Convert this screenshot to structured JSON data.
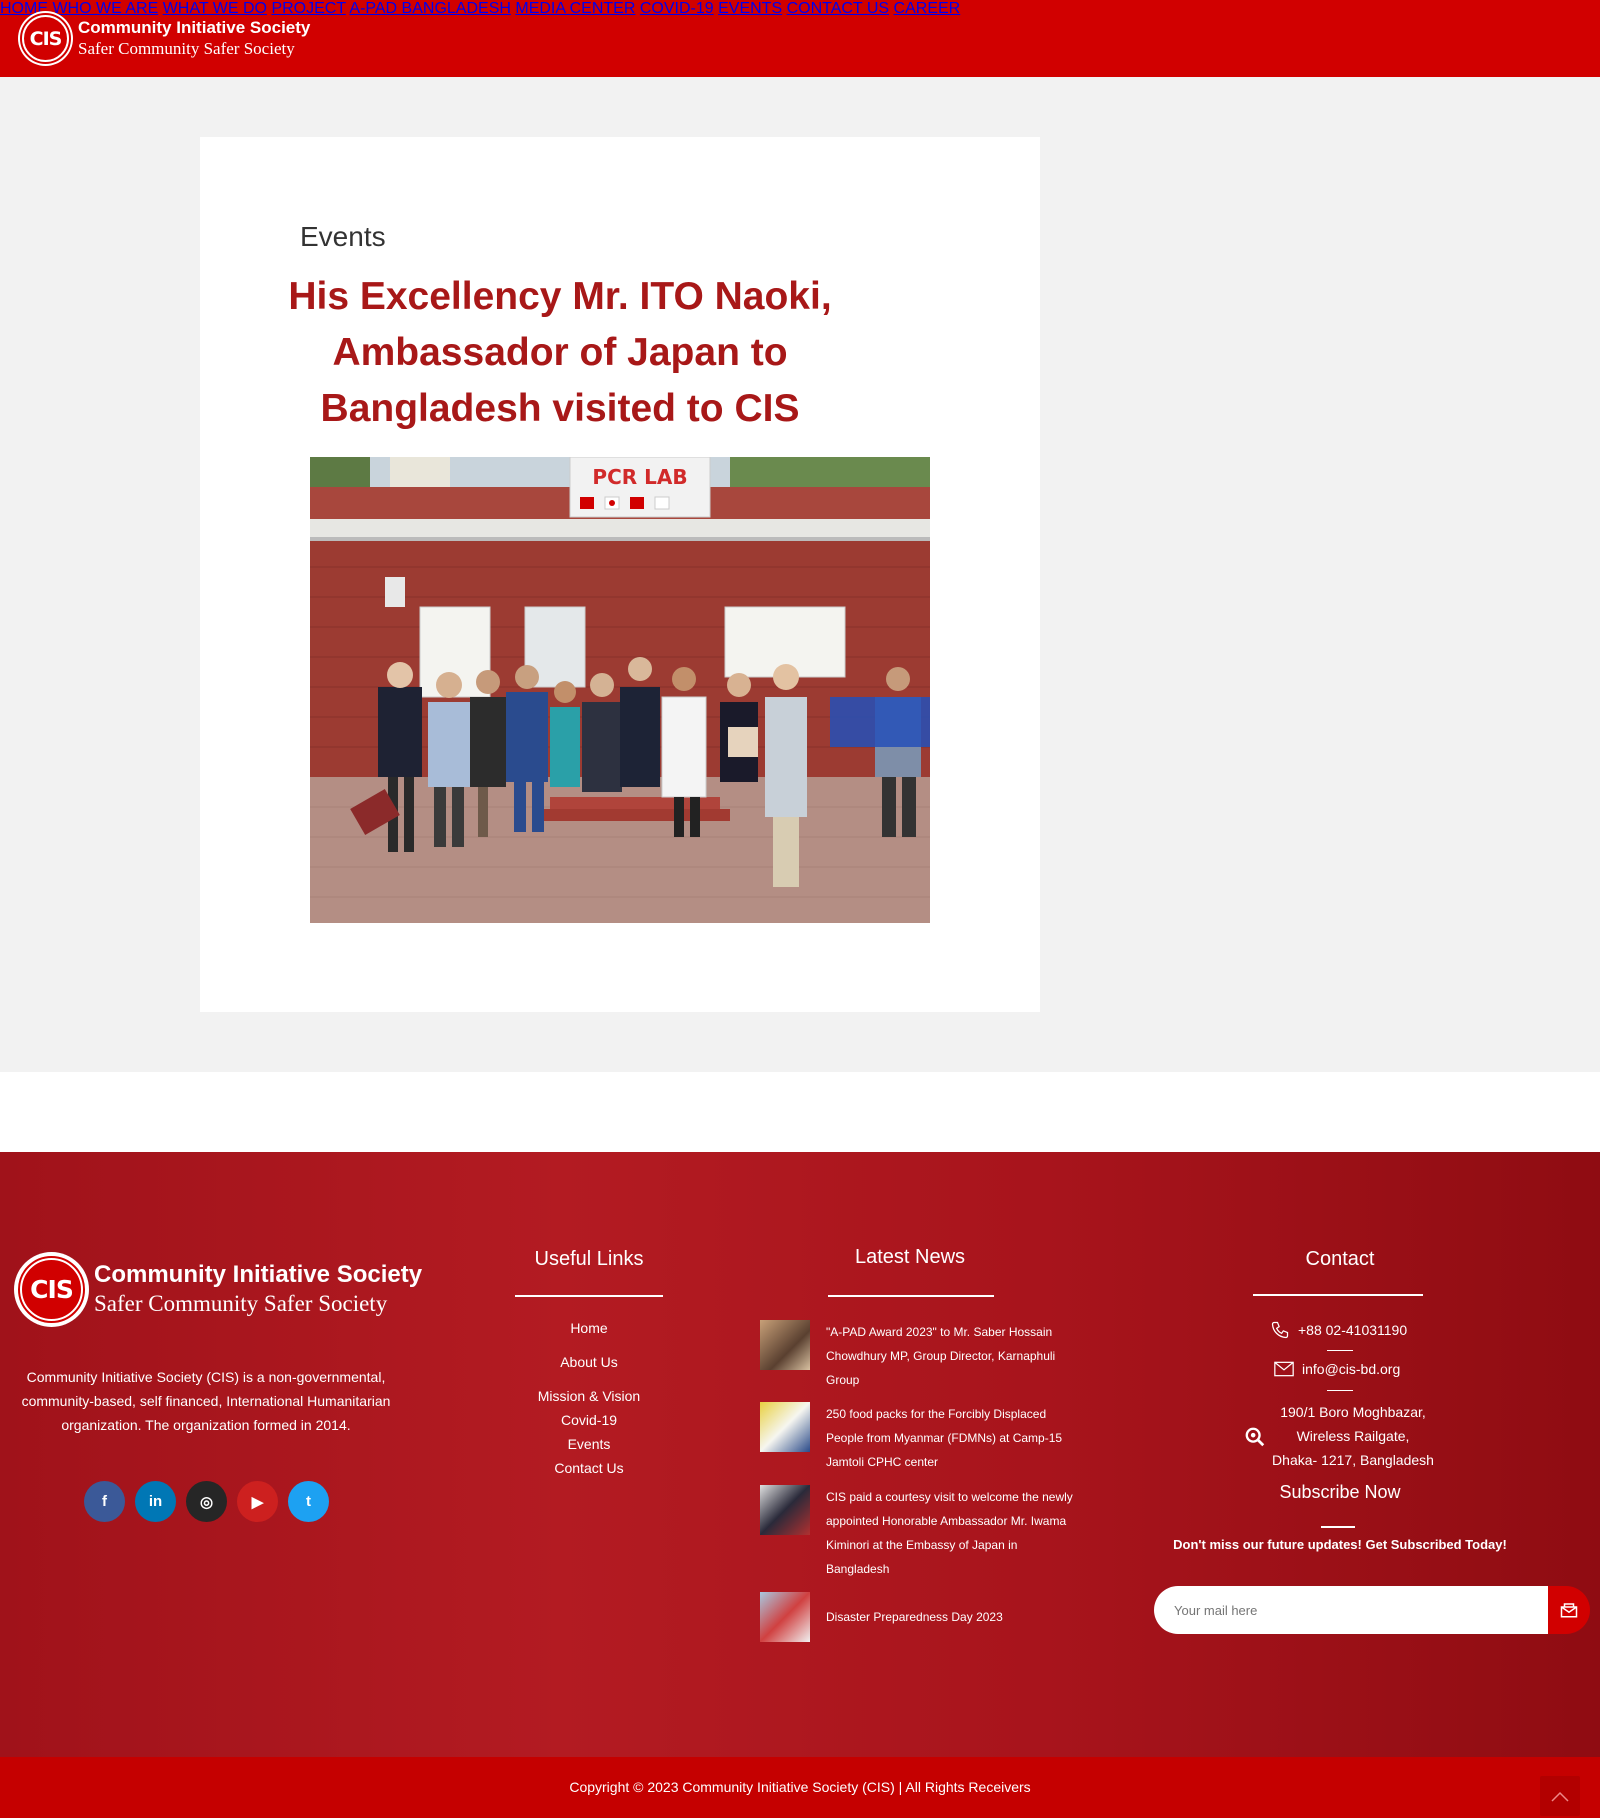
{
  "brand": {
    "name": "Community Initiative Society",
    "tagline": "Safer Community Safer Society",
    "badge": "CIS",
    "primary_color": "#d10000"
  },
  "nav": {
    "items": [
      "HOME",
      "WHO WE ARE",
      "WHAT WE DO",
      "PROJECT",
      "A-PAD BANGLADESH",
      "MEDIA CENTER",
      "COVID-19",
      "EVENTS",
      "CONTACT US",
      "CAREER"
    ]
  },
  "post": {
    "category": "Events",
    "title": "His Excellency Mr. ITO Naoki, Ambassador of Japan to Bangladesh visited to CIS",
    "image_sign_text": "PCR LAB"
  },
  "footer": {
    "about": "Community Initiative Society (CIS) is a non-governmental, community-based, self financed, International Humanitarian organization. The organization formed in 2014.",
    "socials": [
      {
        "name": "facebook-icon",
        "glyph": "f"
      },
      {
        "name": "linkedin-icon",
        "glyph": "in"
      },
      {
        "name": "instagram-icon",
        "glyph": "◎"
      },
      {
        "name": "youtube-icon",
        "glyph": "▶"
      },
      {
        "name": "twitter-icon",
        "glyph": "t"
      }
    ],
    "useful_links": {
      "heading": "Useful Links",
      "items": [
        "Home",
        "About Us",
        "Mission & Vision",
        "Covid-19",
        "Events",
        "Contact Us"
      ]
    },
    "latest_news": {
      "heading": "Latest News",
      "items": [
        "\"A-PAD Award 2023\" to Mr. Saber Hossain Chowdhury MP, Group Director, Karnaphuli Group",
        "250 food packs for the Forcibly Displaced People from Myanmar (FDMNs) at Camp-15 Jamtoli CPHC center",
        "CIS paid a courtesy visit to welcome the newly appointed Honorable Ambassador Mr. Iwama Kiminori at the Embassy of Japan in Bangladesh",
        "Disaster Preparedness Day 2023"
      ]
    },
    "contact": {
      "heading": "Contact",
      "phone": "+88 02-41031190",
      "email": "info@cis-bd.org",
      "address_lines": [
        "190/1 Boro Moghbazar,",
        "Wireless Railgate,",
        "Dhaka- 1217, Bangladesh"
      ]
    },
    "subscribe": {
      "heading": "Subscribe Now",
      "subtext": "Don't miss our future updates! Get Subscribed Today!",
      "placeholder": "Your mail here"
    },
    "copyright": "Copyright © 2023 Community Initiative Society (CIS) | All Rights Receivers"
  }
}
